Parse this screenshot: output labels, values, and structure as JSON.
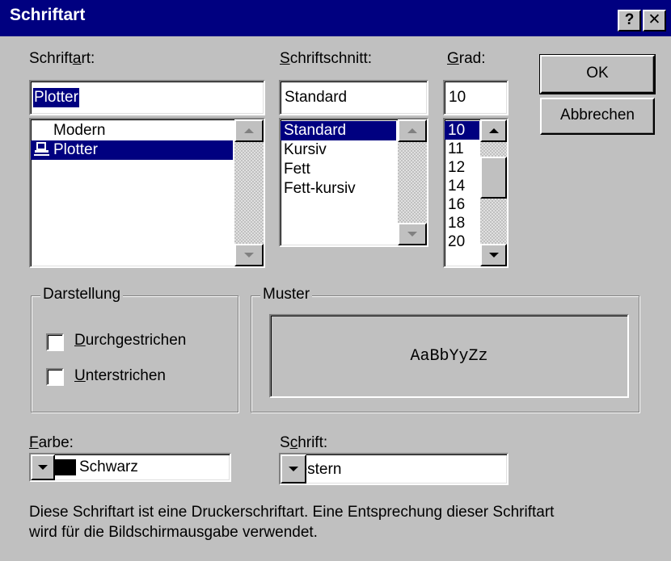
{
  "window": {
    "title": "Schriftart",
    "help_label": "?",
    "close_label": "✕"
  },
  "font": {
    "label_pre": "Schrift",
    "label_u": "a",
    "label_post": "rt:",
    "value": "Plotter",
    "items": [
      {
        "label": "Modern",
        "icon": "none"
      },
      {
        "label": "Plotter",
        "icon": "printer-font-icon"
      }
    ]
  },
  "style": {
    "label_u": "S",
    "label_post": "chriftschnitt:",
    "value": "Standard",
    "items": [
      "Standard",
      "Kursiv",
      "Fett",
      "Fett-kursiv"
    ]
  },
  "size": {
    "label_u": "G",
    "label_post": "rad:",
    "value": "10",
    "items": [
      "10",
      "11",
      "12",
      "14",
      "16",
      "18",
      "20"
    ]
  },
  "buttons": {
    "ok": "OK",
    "cancel": "Abbrechen"
  },
  "effects": {
    "title": "Darstellung",
    "strike_u": "D",
    "strike_post": "urchgestrichen",
    "underline_u": "U",
    "underline_post": "nterstrichen",
    "strike_checked": false,
    "underline_checked": false
  },
  "sample": {
    "title": "Muster",
    "text": "AaBbYyZz"
  },
  "color": {
    "label_u": "F",
    "label_post": "arbe:",
    "value": "Schwarz",
    "swatch": "#000000"
  },
  "script": {
    "label_pre": "S",
    "label_u": "c",
    "label_post": "hrift:",
    "value": "Western"
  },
  "info": {
    "line1": "Diese Schriftart ist eine Druckerschriftart. Eine Entsprechung dieser Schriftart",
    "line2": "wird für die Bildschirmausgabe verwendet."
  },
  "colors": {
    "titlebar": "#000080",
    "face": "#c0c0c0",
    "selection": "#000080"
  }
}
